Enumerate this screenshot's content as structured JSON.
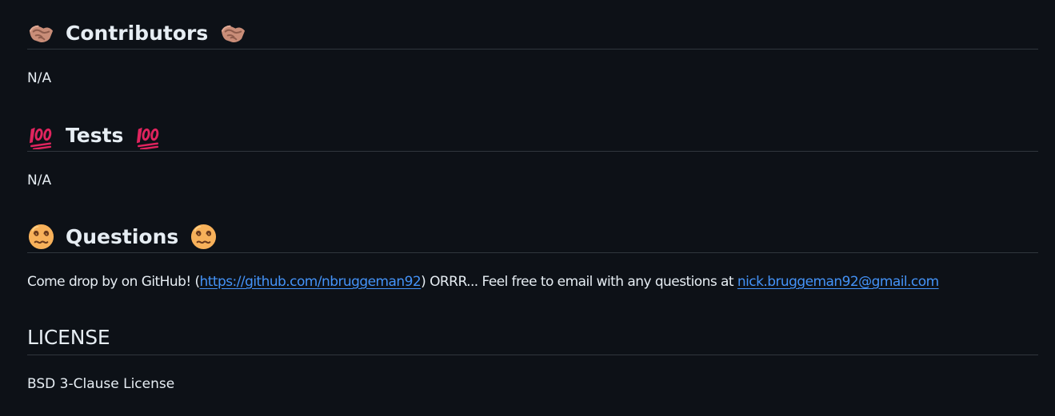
{
  "sections": [
    {
      "title": "Contributors",
      "icon": "handshake-icon",
      "content": "N/A"
    },
    {
      "title": "Tests",
      "icon": "hundred-points-icon",
      "content": "N/A"
    },
    {
      "title": "Questions",
      "icon": "dizzy-face-icon",
      "content": {
        "prefix": "Come drop by on GitHub! (",
        "github_link": "https://github.com/nbruggeman92",
        "middle": ") ORRR... Feel free to email with any questions at ",
        "email_link": "nick.bruggeman92@gmail.com"
      }
    },
    {
      "title": "LICENSE",
      "content": "BSD 3-Clause License"
    }
  ],
  "colors": {
    "background": "#0d1117",
    "text": "#e6edf3",
    "divider": "#30363d",
    "link": "#4493f8",
    "hundred_red": "#e0245e",
    "face_yellow": "#f7b15a",
    "handshake_skin": "#c98d78"
  }
}
